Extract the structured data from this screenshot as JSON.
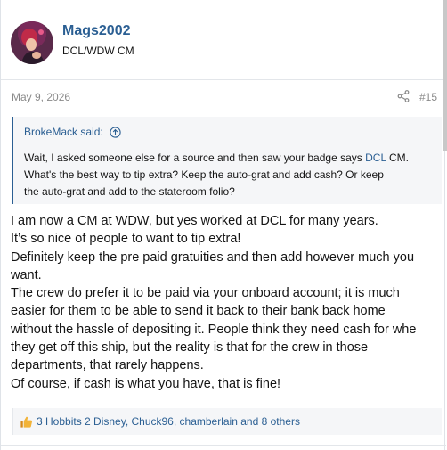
{
  "post": {
    "author": {
      "username": "Mags2002",
      "title": "DCL/WDW CM"
    },
    "date": "May 9, 2026",
    "number": "#15",
    "quote": {
      "attribution": "BrokeMack said:",
      "line1_pre": "Wait, I asked someone else for a source and then saw your badge says ",
      "line1_link": "DCL",
      "line1_post": " CM.",
      "line2": "What's the best way to tip extra? Keep the auto-grat and add cash? Or keep",
      "line3": "the auto-grat and add to the stateroom folio?"
    },
    "message": [
      "I am now a CM at WDW, but yes worked at DCL for many years.",
      "It’s so nice of people to want to tip extra!",
      "Definitely keep the pre paid gratuities and then add however much you",
      "want.",
      "The crew do prefer it to be paid via your onboard account; it is much",
      "easier for them to be able to send it back to their bank back home",
      "without the hassle of depositing it. People think they need cash for whe",
      "they get off this ship, but the reality is that for the crew in those",
      "departments, that rarely happens.",
      "Of course, if cash is what you have, that is fine!"
    ],
    "reactions": "3 Hobbits 2 Disney, Chuck96, chamberlain and 8 others"
  },
  "icons": {
    "share": "share-icon",
    "quote_jump": "arrow-up-circle-icon",
    "reaction": "thumbs-up-icon"
  },
  "colors": {
    "link": "#2b5f93",
    "meta": "#8a8a8a",
    "quote_bg": "#f5f6f8"
  }
}
